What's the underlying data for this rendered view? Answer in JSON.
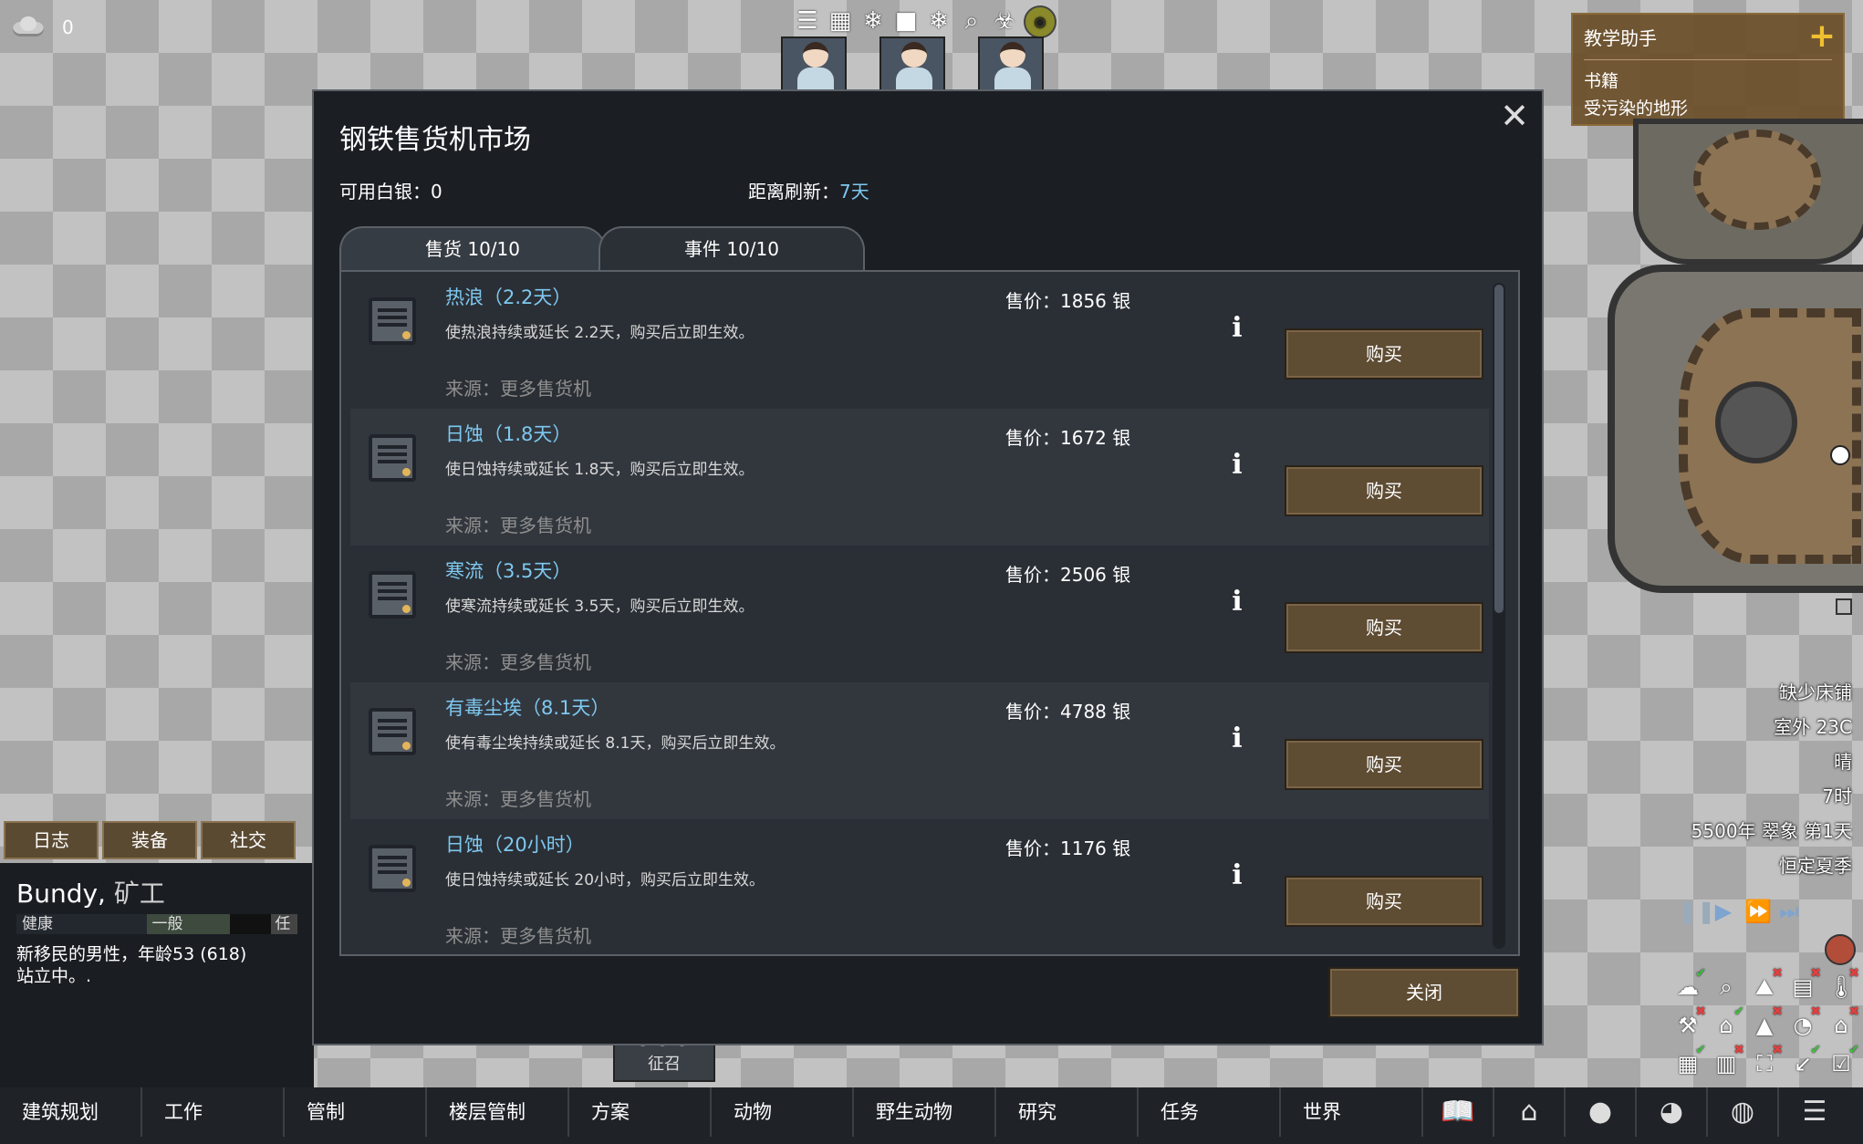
{
  "hud": {
    "wealth_value": "0",
    "tutor": {
      "title": "教学助手",
      "items": [
        "书籍",
        "受污染的地形"
      ]
    },
    "status": [
      "缺少床铺",
      "室外 23C",
      "晴",
      "7时",
      "5500年 翠象 第1天",
      "恒定夏季"
    ]
  },
  "pawn": {
    "tabs": [
      "日志",
      "装备",
      "社交"
    ],
    "name": "Bundy",
    "title": "矿工",
    "health_label": "健康",
    "mood_label": "一般",
    "extra_label": "任",
    "description": "新移民的男性，年龄53 (618)",
    "activity": "站立中。."
  },
  "draft": {
    "label": "征召"
  },
  "bottom_tabs": [
    "建筑规划",
    "工作",
    "管制",
    "楼层管制",
    "方案",
    "动物",
    "野生动物",
    "研究",
    "任务",
    "世界"
  ],
  "dialog": {
    "title": "钢铁售货机市场",
    "silver_label": "可用白银：0",
    "refresh_label": "距离刷新：",
    "refresh_value": "7天",
    "tabs": [
      "售货 10/10",
      "事件 10/10"
    ],
    "buy_label": "购买",
    "close_label": "关闭",
    "items": [
      {
        "name": "热浪（2.2天）",
        "desc": "使热浪持续或延长 2.2天，购买后立即生效。",
        "source": "来源：更多售货机",
        "price": "售价：1856 银"
      },
      {
        "name": "日蚀（1.8天）",
        "desc": "使日蚀持续或延长 1.8天，购买后立即生效。",
        "source": "来源：更多售货机",
        "price": "售价：1672 银"
      },
      {
        "name": "寒流（3.5天）",
        "desc": "使寒流持续或延长 3.5天，购买后立即生效。",
        "source": "来源：更多售货机",
        "price": "售价：2506 银"
      },
      {
        "name": "有毒尘埃（8.1天）",
        "desc": "使有毒尘埃持续或延长 8.1天，购买后立即生效。",
        "source": "来源：更多售货机",
        "price": "售价：4788 银"
      },
      {
        "name": "日蚀（20小时）",
        "desc": "使日蚀持续或延长 20小时，购买后立即生效。",
        "source": "来源：更多售货机",
        "price": "售价：1176 银"
      }
    ]
  }
}
